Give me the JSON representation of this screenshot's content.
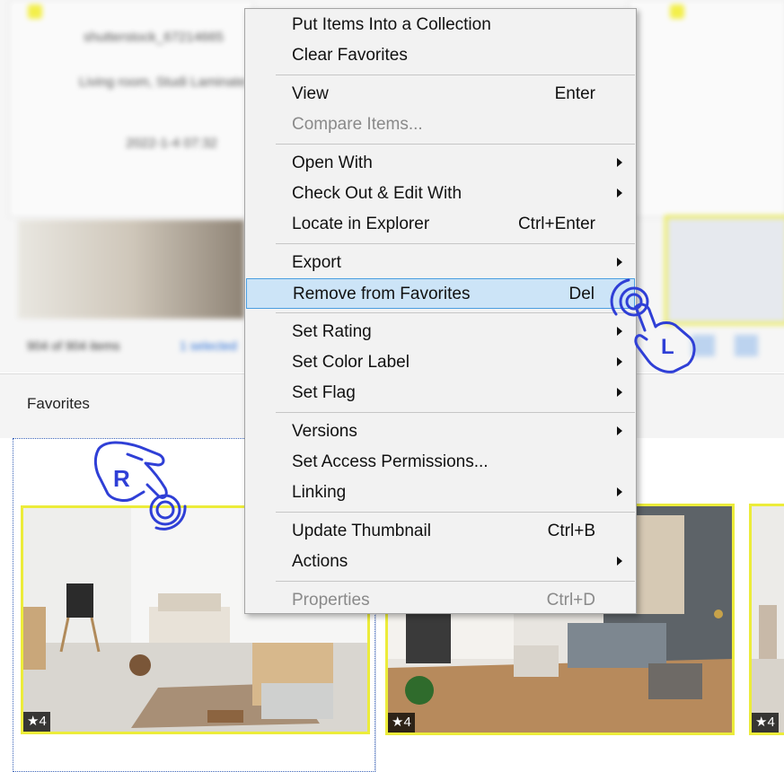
{
  "background": {
    "cards": [
      {
        "filename": "shutterstock_67214665",
        "title": "Living room, Studi Laminate",
        "date": "2022-1-4 07:32"
      }
    ],
    "status": {
      "count_text": "904 of 904 items",
      "selected_text": "1 selected"
    }
  },
  "favorites_panel": {
    "title": "Favorites",
    "thumbnails": [
      {
        "rating": "★4"
      },
      {
        "rating": "★4"
      },
      {
        "rating": "★4"
      }
    ]
  },
  "context_menu": {
    "groups": [
      [
        {
          "label": "Put Items Into a Collection",
          "shortcut": "",
          "submenu": false,
          "disabled": false
        },
        {
          "label": "Clear Favorites",
          "shortcut": "",
          "submenu": false,
          "disabled": false
        }
      ],
      [
        {
          "label": "View",
          "shortcut": "Enter",
          "submenu": false,
          "disabled": false
        },
        {
          "label": "Compare Items...",
          "shortcut": "",
          "submenu": false,
          "disabled": true
        }
      ],
      [
        {
          "label": "Open With",
          "shortcut": "",
          "submenu": true,
          "disabled": false
        },
        {
          "label": "Check Out & Edit With",
          "shortcut": "",
          "submenu": true,
          "disabled": false
        },
        {
          "label": "Locate in Explorer",
          "shortcut": "Ctrl+Enter",
          "submenu": false,
          "disabled": false
        }
      ],
      [
        {
          "label": "Export",
          "shortcut": "",
          "submenu": true,
          "disabled": false
        },
        {
          "label": "Remove from Favorites",
          "shortcut": "Del",
          "submenu": false,
          "disabled": false,
          "highlighted": true
        }
      ],
      [
        {
          "label": "Set Rating",
          "shortcut": "",
          "submenu": true,
          "disabled": false
        },
        {
          "label": "Set Color Label",
          "shortcut": "",
          "submenu": true,
          "disabled": false
        },
        {
          "label": "Set Flag",
          "shortcut": "",
          "submenu": true,
          "disabled": false
        }
      ],
      [
        {
          "label": "Versions",
          "shortcut": "",
          "submenu": true,
          "disabled": false
        },
        {
          "label": "Set Access Permissions...",
          "shortcut": "",
          "submenu": false,
          "disabled": false
        },
        {
          "label": "Linking",
          "shortcut": "",
          "submenu": true,
          "disabled": false
        }
      ],
      [
        {
          "label": "Update Thumbnail",
          "shortcut": "Ctrl+B",
          "submenu": false,
          "disabled": false
        },
        {
          "label": "Actions",
          "shortcut": "",
          "submenu": true,
          "disabled": false
        }
      ],
      [
        {
          "label": "Properties",
          "shortcut": "Ctrl+D",
          "submenu": false,
          "disabled": true
        }
      ]
    ]
  },
  "gestures": {
    "right_click_letter": "R",
    "left_click_letter": "L",
    "color": "#2f3fd6"
  }
}
